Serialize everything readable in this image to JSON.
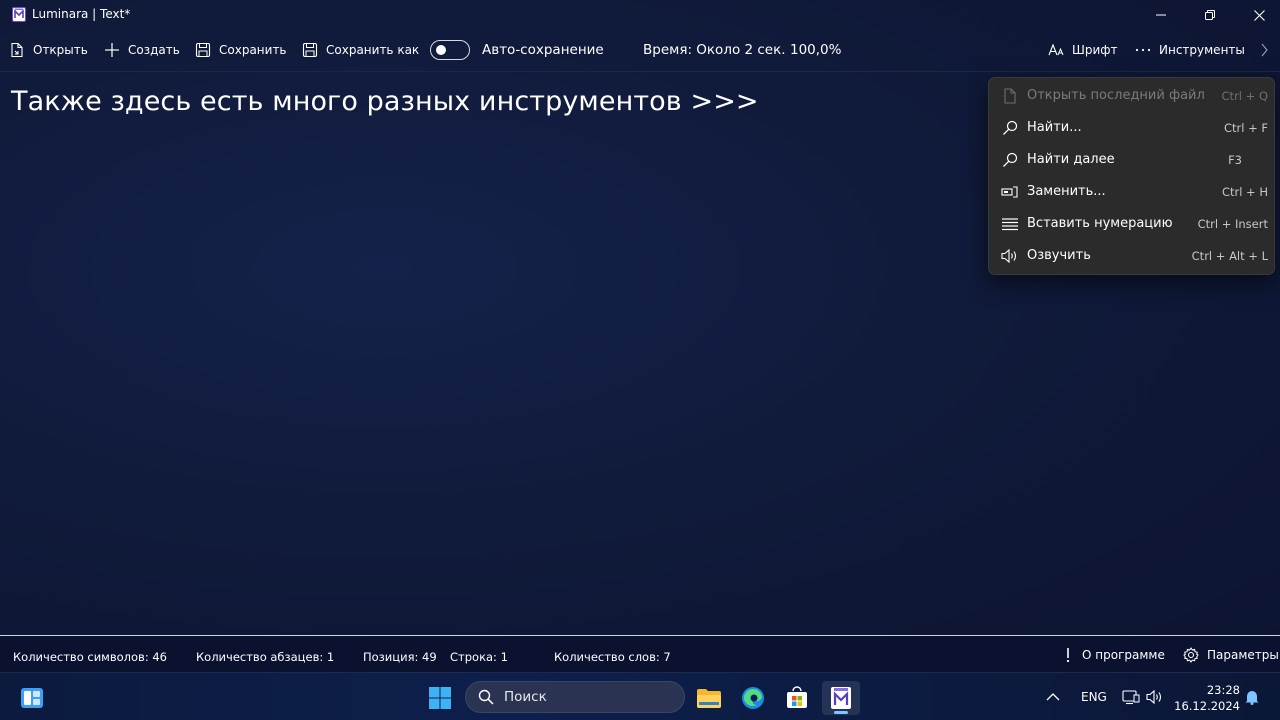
{
  "window": {
    "title": "Luminara | Text*"
  },
  "toolbar": {
    "open_label": "Открыть",
    "create_label": "Создать",
    "save_label": "Сохранить",
    "save_as_label": "Сохранить как",
    "autosave_label": "Авто-сохранение",
    "time_label": "Время: Около 2 сек.",
    "zoom_label": "100,0%",
    "font_label": "Шрифт",
    "tools_label": "Инструменты"
  },
  "editor": {
    "text": "Также здесь есть много разных инструментов >>>"
  },
  "menu": {
    "items": [
      {
        "label": "Открыть последний файл",
        "shortcut": "Ctrl + Q",
        "icon": "file-icon",
        "enabled": false
      },
      {
        "label": "Найти...",
        "shortcut": "Ctrl + F",
        "icon": "search-icon",
        "enabled": true
      },
      {
        "label": "Найти далее",
        "shortcut": "F3",
        "icon": "search-icon",
        "enabled": true
      },
      {
        "label": "Заменить...",
        "shortcut": "Ctrl + H",
        "icon": "replace-icon",
        "enabled": true
      },
      {
        "label": "Вставить нумерацию",
        "shortcut": "Ctrl + Insert",
        "icon": "list-icon",
        "enabled": true
      },
      {
        "label": "Озвучить",
        "shortcut": "Ctrl + Alt + L",
        "icon": "speaker-icon",
        "enabled": true
      }
    ]
  },
  "statusbar": {
    "char_count": "Количество символов: 46",
    "paragraph_count": "Количество абзацев: 1",
    "position": "Позиция: 49",
    "line": "Строка: 1",
    "word_count": "Количество слов: 7",
    "about_label": "О программе",
    "settings_label": "Параметры"
  },
  "taskbar": {
    "search_label": "Поиск",
    "lang": "ENG",
    "time": "23:28",
    "date": "16.12.2024"
  },
  "colors": {
    "background": "#101a3a",
    "menu_background": "#2b2b2b",
    "taskbar_accent": "#7fc4ff"
  }
}
